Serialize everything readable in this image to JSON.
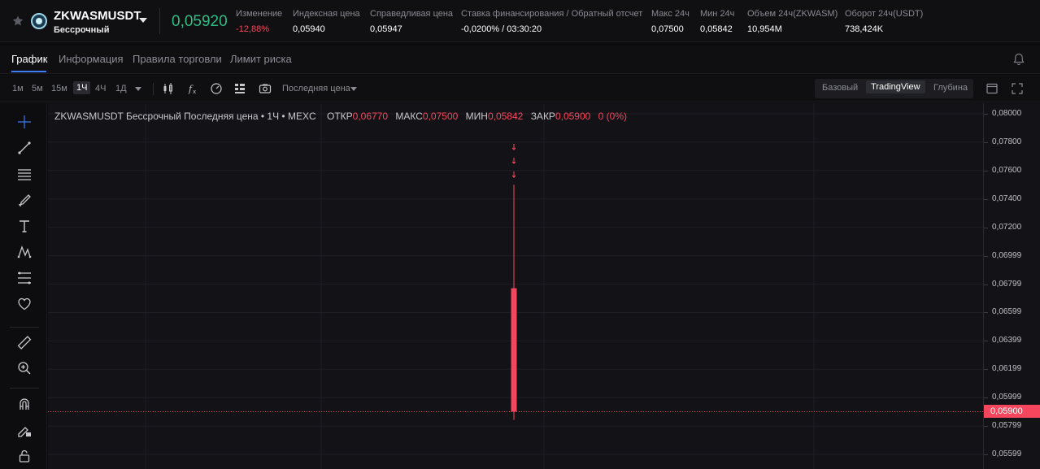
{
  "ticker": {
    "symbol": "ZKWASMUSDT",
    "contract_type": "Бессрочный",
    "last_price": "0,05920",
    "stats": [
      {
        "label": "Изменение",
        "value": "-12,88%",
        "negative": true
      },
      {
        "label": "Индексная цена",
        "value": "0,05940",
        "negative": false
      },
      {
        "label": "Справедливая цена",
        "value": "0,05947",
        "negative": false
      },
      {
        "label": "Ставка финансирования / Обратный отсчет",
        "value": "-0,0200% / 03:30:20",
        "negative": false
      },
      {
        "label": "Макс 24ч",
        "value": "0,07500",
        "negative": false
      },
      {
        "label": "Мин 24ч",
        "value": "0,05842",
        "negative": false
      },
      {
        "label": "Объем 24ч(ZKWASM)",
        "value": "10,954M",
        "negative": false
      },
      {
        "label": "Оборот 24ч(USDT)",
        "value": "738,424K",
        "negative": false
      }
    ]
  },
  "tabs": [
    {
      "label": "График",
      "active": true
    },
    {
      "label": "Информация",
      "active": false
    },
    {
      "label": "Правила торговли",
      "active": false
    },
    {
      "label": "Лимит риска",
      "active": false
    }
  ],
  "toolbar": {
    "timeframes": [
      {
        "label": "1м",
        "active": false
      },
      {
        "label": "5м",
        "active": false
      },
      {
        "label": "15м",
        "active": false
      },
      {
        "label": "1Ч",
        "active": true
      },
      {
        "label": "4Ч",
        "active": false
      },
      {
        "label": "1Д",
        "active": false
      }
    ],
    "price_type": "Последняя цена",
    "views": [
      {
        "label": "Базовый",
        "active": false
      },
      {
        "label": "TradingView",
        "active": true
      },
      {
        "label": "Глубина",
        "active": false
      }
    ],
    "icons": [
      "candles-icon",
      "indicators-icon",
      "templates-icon",
      "layout-icon",
      "screenshot-icon",
      "settings-icon",
      "fullscreen-icon"
    ]
  },
  "sidebar": {
    "tools": [
      "crosshair-icon",
      "trend-line-icon",
      "horizontal-lines-icon",
      "brush-icon",
      "text-icon",
      "pattern-icon",
      "fib-icon",
      "heart-icon",
      "ruler-icon",
      "zoom-in-icon",
      "magnet-icon",
      "pencil-lock-icon",
      "lock-icon"
    ]
  },
  "chart": {
    "title": "ZKWASMUSDT Бессрочный Последняя цена • 1Ч • MEXC",
    "ohlc": [
      {
        "key": "ОТКР",
        "value": "0,06770"
      },
      {
        "key": "МАКС",
        "value": "0,07500"
      },
      {
        "key": "МИН",
        "value": "0,05842"
      },
      {
        "key": "ЗАКР",
        "value": "0,05900"
      },
      {
        "key": "",
        "value": "0 (0%)"
      }
    ],
    "current_price_tag": "0,05900",
    "current_price": 0.059,
    "colors": {
      "up": "#2ebd85",
      "down": "#f6465d",
      "grid": "#1e1e24"
    }
  },
  "chart_data": {
    "type": "candlestick",
    "title": "ZKWASMUSDT Бессрочный Последняя цена • 1Ч • MEXC",
    "interval": "1Ч",
    "candles": [
      {
        "open": 0.0677,
        "high": 0.075,
        "low": 0.05842,
        "close": 0.059
      }
    ],
    "y_ticks": [
      "0,08000",
      "0,07800",
      "0,07600",
      "0,07400",
      "0,07200",
      "0,06999",
      "0,06799",
      "0,06599",
      "0,06399",
      "0,06199",
      "0,05999",
      "0,05799",
      "0,05599"
    ],
    "ylim": [
      0.0555,
      0.0805
    ],
    "grid": true
  }
}
